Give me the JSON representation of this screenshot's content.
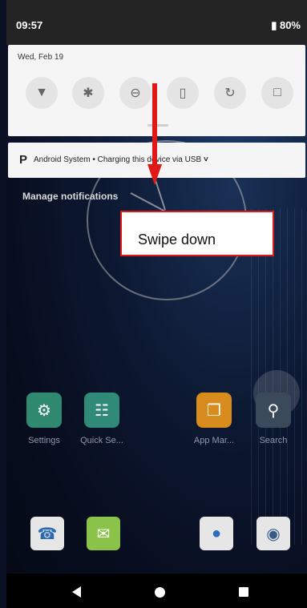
{
  "status_bar": {
    "time": "09:57",
    "battery": "80%",
    "battery_icon": "battery-icon"
  },
  "quick_settings": {
    "date": "Wed, Feb 19",
    "tiles": [
      {
        "name": "wifi",
        "icon": "wifi-icon",
        "glyph": "▼"
      },
      {
        "name": "bluetooth",
        "icon": "bluetooth-icon",
        "glyph": "✱"
      },
      {
        "name": "do-not-disturb",
        "icon": "dnd-icon",
        "glyph": "⊖"
      },
      {
        "name": "flashlight",
        "icon": "flashlight-icon",
        "glyph": "▯"
      },
      {
        "name": "auto-rotate",
        "icon": "rotate-icon",
        "glyph": "↻"
      },
      {
        "name": "battery-saver",
        "icon": "battery-saver-icon",
        "glyph": "□"
      }
    ]
  },
  "notification": {
    "app_icon": "P",
    "text": "Android System • Charging this device via USB",
    "chevron": "˅"
  },
  "manage_notifications": "Manage notifications",
  "callout": {
    "text": "Swipe down",
    "color": "#e01818"
  },
  "apps": [
    {
      "label": "Settings",
      "icon": "gear-icon",
      "glyph": "⚙",
      "color": "#2f8a70"
    },
    {
      "label": "Quick Se...",
      "icon": "sliders-icon",
      "glyph": "☷",
      "color": "#2f8a78"
    },
    {
      "label": "App Mar...",
      "icon": "store-icon",
      "glyph": "❐",
      "color": "#d98c1e"
    },
    {
      "label": "Search",
      "icon": "search-icon",
      "glyph": "⚲",
      "color": "#3a4a5a"
    }
  ],
  "dock": [
    {
      "icon": "phone-icon",
      "glyph": "☎",
      "color": "#e6e6e6"
    },
    {
      "icon": "messages-icon",
      "glyph": "✉",
      "color": "#8bc34a"
    },
    {
      "icon": "browser-icon",
      "glyph": "●",
      "color": "#e6e6e6"
    },
    {
      "icon": "camera-icon",
      "glyph": "◉",
      "color": "#e6e6e6"
    }
  ]
}
